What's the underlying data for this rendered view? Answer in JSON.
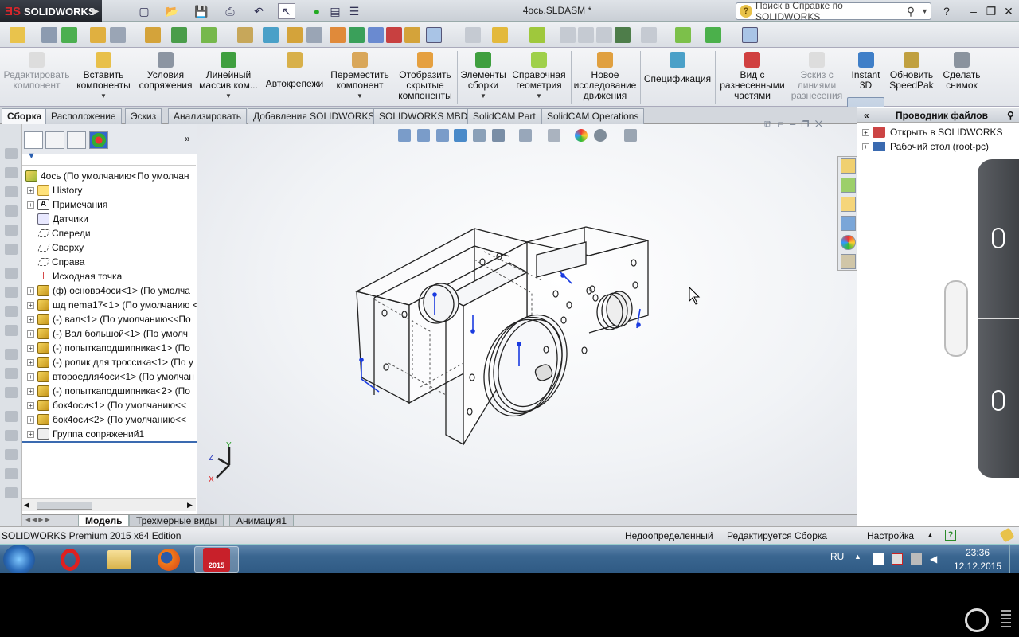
{
  "app": {
    "logo_text": "SOLIDWORKS",
    "doc_title": "4ось.SLDASM *"
  },
  "help_search": {
    "placeholder": "Поиск в Справке по SOLIDWORKS"
  },
  "ribbon": {
    "buttons": [
      {
        "label": "Редактировать компонент",
        "disabled": true
      },
      {
        "label": "Вставить компоненты"
      },
      {
        "label": "Условия сопряжения"
      },
      {
        "label": "Линейный массив ком..."
      },
      {
        "label": "Автокрепежи"
      },
      {
        "label": "Переместить компонент"
      },
      {
        "label": "Отобразить скрытые компоненты"
      },
      {
        "label": "Элементы сборки"
      },
      {
        "label": "Справочная геометрия"
      },
      {
        "label": "Новое исследование движения"
      },
      {
        "label": "Спецификация"
      },
      {
        "label": "Вид с разнесенными частями"
      },
      {
        "label": "Эскиз с линиями разнесения",
        "disabled": true
      },
      {
        "label": "Instant 3D",
        "active": true
      },
      {
        "label": "Обновить SpeedPak"
      },
      {
        "label": "Сделать снимок"
      }
    ]
  },
  "tabs": [
    "Сборка",
    "Расположение",
    "Эскиз",
    "Анализировать",
    "Добавления SOLIDWORKS",
    "SOLIDWORKS MBD",
    "SolidCAM Part",
    "SolidCAM Operations"
  ],
  "tree": {
    "root": "4ось  (По умолчанию<По умолчан",
    "items": [
      {
        "label": "History",
        "icon": "folder",
        "expand": true
      },
      {
        "label": "Примечания",
        "icon": "note",
        "expand": true
      },
      {
        "label": "Датчики",
        "icon": "sensor",
        "expand": false
      },
      {
        "label": "Спереди",
        "icon": "plane",
        "expand": false
      },
      {
        "label": "Сверху",
        "icon": "plane",
        "expand": false
      },
      {
        "label": "Справа",
        "icon": "plane",
        "expand": false
      },
      {
        "label": "Исходная точка",
        "icon": "origin",
        "expand": false
      },
      {
        "label": "(ф) основа4оси<1> (По умолча",
        "icon": "part",
        "expand": true
      },
      {
        "label": "шд nema17<1> (По умолчанию <",
        "icon": "part",
        "expand": true
      },
      {
        "label": "(-) вал<1> (По умолчанию<<По",
        "icon": "part",
        "expand": true
      },
      {
        "label": "(-) Вал большой<1> (По умолч",
        "icon": "part",
        "expand": true
      },
      {
        "label": "(-) попыткаподшипника<1> (По",
        "icon": "part",
        "expand": true
      },
      {
        "label": "(-) ролик для троссика<1> (По у",
        "icon": "part",
        "expand": true
      },
      {
        "label": "второедля4оси<1> (По умолчан",
        "icon": "part",
        "expand": true
      },
      {
        "label": "(-) попыткаподшипника<2> (По",
        "icon": "part",
        "expand": true
      },
      {
        "label": "бок4оси<1> (По умолчанию<<",
        "icon": "part",
        "expand": true
      },
      {
        "label": "бок4оси<2> (По умолчанию<<",
        "icon": "part",
        "expand": true
      },
      {
        "label": "Группа сопряжений1",
        "icon": "mates",
        "expand": true
      }
    ]
  },
  "bottom_tabs": [
    "Модель",
    "Трехмерные виды",
    "Анимация1"
  ],
  "right_panel": {
    "title": "Проводник файлов",
    "items": [
      "Открыть в SOLIDWORKS",
      "Рабочий стол (root-pc)"
    ]
  },
  "status": {
    "edition": "SOLIDWORKS Premium 2015 x64 Edition",
    "state": "Недоопределенный",
    "editing": "Редактируется Сборка",
    "settings": "Настройка",
    "help": "?"
  },
  "taskbar": {
    "lang": "RU",
    "time": "23:36",
    "date": "12.12.2015",
    "sw_badge": "2015"
  },
  "triad": {
    "x": "X",
    "y": "Y",
    "z": "Z"
  }
}
